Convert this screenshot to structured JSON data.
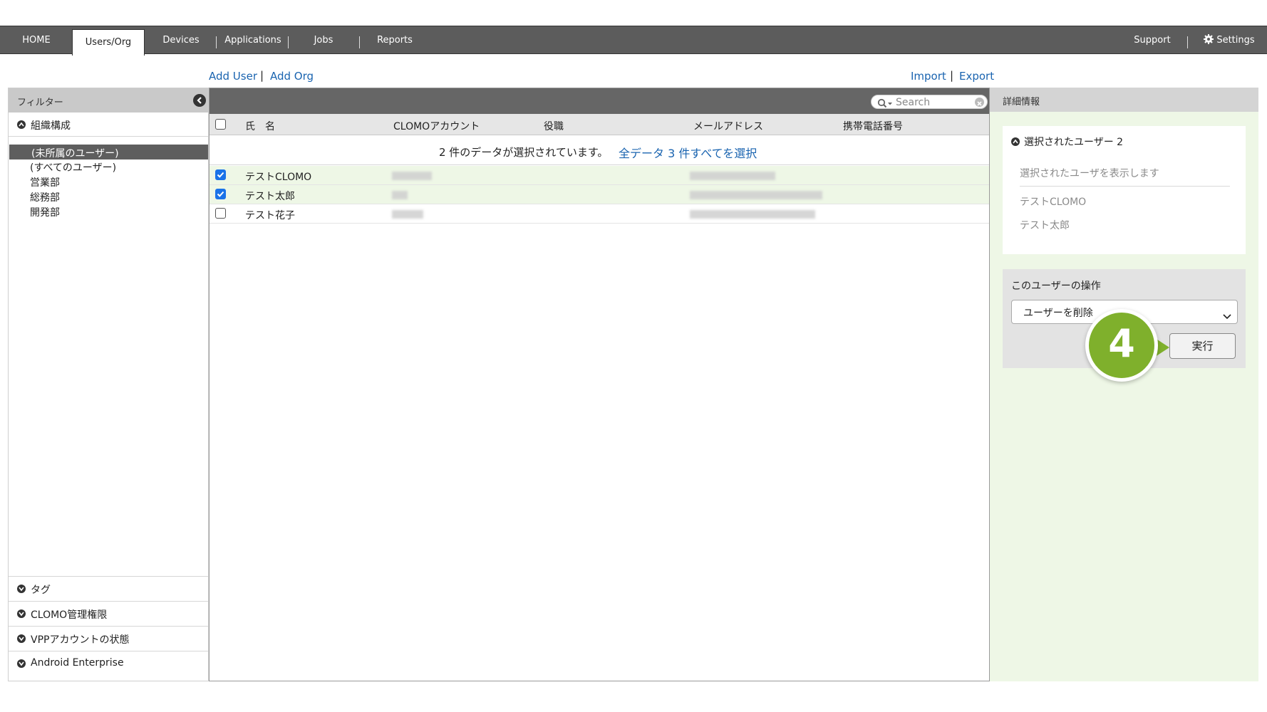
{
  "nav": {
    "tabs": [
      "HOME",
      "Users/Org",
      "Devices",
      "Applications",
      "Jobs",
      "Reports"
    ],
    "active_tab": "Users/Org",
    "support": "Support",
    "settings": "Settings"
  },
  "actions": {
    "add_user": "Add User",
    "add_org": "Add Org",
    "import": "Import",
    "export": "Export",
    "separator": "|"
  },
  "filter": {
    "title": "フィルター",
    "org_section": "組織構成",
    "org_items": [
      "(未所属のユーザー)",
      "(すべてのユーザー)",
      "営業部",
      "総務部",
      "開発部"
    ],
    "selected_org": "(未所属のユーザー)",
    "footer_sections": [
      "タグ",
      "CLOMO管理権限",
      "VPPアカウントの状態",
      "Android Enterprise"
    ]
  },
  "list": {
    "search_placeholder": "Search",
    "columns": [
      "氏　名",
      "CLOMOアカウント",
      "役職",
      "メールアドレス",
      "携帯電話番号"
    ],
    "selection_message": "2 件のデータが選択されています。",
    "select_all_link": "全データ 3 件すべてを選択",
    "rows": [
      {
        "name": "テストCLOMO",
        "checked": true
      },
      {
        "name": "テスト太郎",
        "checked": true
      },
      {
        "name": "テスト花子",
        "checked": false
      }
    ]
  },
  "details": {
    "title": "詳細情報",
    "selected_users_label": "選択されたユーザー 2",
    "show_selected_hint": "選択されたユーザを表示します",
    "selected_users": [
      "テストCLOMO",
      "テスト太郎"
    ],
    "operation_label": "このユーザーの操作",
    "operation_value": "ユーザーを削除",
    "run_button": "実行"
  },
  "annotation": {
    "step": "4",
    "color": "#7fb02c"
  }
}
